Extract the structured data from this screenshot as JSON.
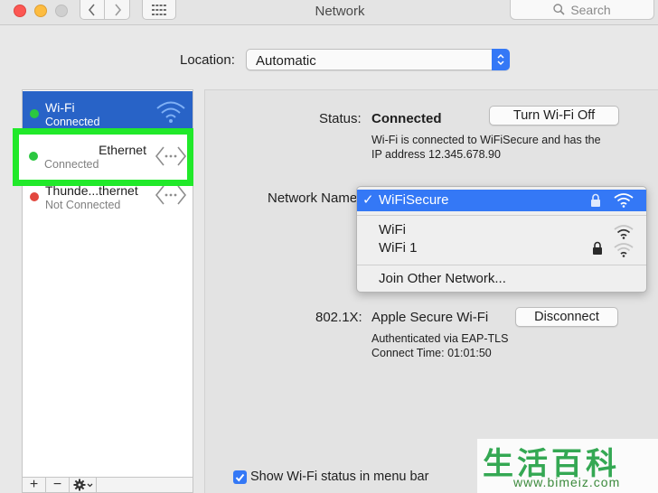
{
  "window": {
    "title": "Network",
    "search_placeholder": "Search"
  },
  "location": {
    "label": "Location:",
    "value": "Automatic"
  },
  "services": [
    {
      "name": "Wi-Fi",
      "status": "Connected",
      "dot_color": "#2bc740",
      "icon": "wifi-icon"
    },
    {
      "name": "Ethernet",
      "status": "Connected",
      "dot_color": "#2bc740",
      "icon": "ethernet-icon"
    },
    {
      "name": "Thunde...thernet",
      "status": "Not Connected",
      "dot_color": "#e2473e",
      "icon": "ethernet-icon"
    }
  ],
  "detail": {
    "status_label": "Status:",
    "status_value": "Connected",
    "turn_off_button": "Turn Wi-Fi Off",
    "status_desc_line1": "Wi-Fi is connected to WiFiSecure and has the",
    "status_desc_line2": "IP address 12.345.678.90",
    "network_name_label": "Network Name",
    "auth_label": "802.1X:",
    "auth_value": "Apple Secure Wi-Fi",
    "disconnect_button": "Disconnect",
    "auth_desc_line1": "Authenticated via EAP-TLS",
    "auth_desc_line2": "Connect Time: 01:01:50",
    "show_status_label": "Show Wi-Fi status in menu bar"
  },
  "network_dropdown": {
    "selected": "WiFiSecure",
    "items": [
      "WiFi",
      "WiFi 1"
    ],
    "join_other": "Join Other Network..."
  },
  "sidebar_tools": [
    "+",
    "−"
  ],
  "watermark": {
    "cn": "生活百科",
    "url": "www.bimeiz.com"
  },
  "colors": {
    "accent": "#3478f6",
    "selection": "#2863c7",
    "highlight": "#21e92a"
  }
}
